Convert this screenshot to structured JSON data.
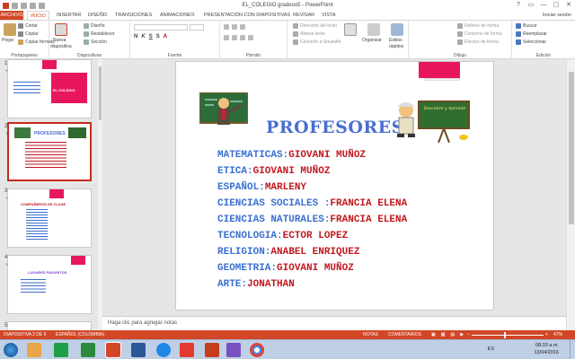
{
  "window": {
    "title": "EL_COLEGIO gradooo5 - PowerPoint"
  },
  "window_buttons": [
    "?",
    "▭",
    "—",
    "▢",
    "✕"
  ],
  "tabs": {
    "file": "ARCHIVO",
    "inicio": "INICIO",
    "insertar": "INSERTAR",
    "diseno": "DISEÑO",
    "transiciones": "TRANSICIONES",
    "animaciones": "ANIMACIONES",
    "presentacion": "PRESENTACIÓN CON DIAPOSITIVAS",
    "revisar": "REVISAR",
    "vista": "VISTA",
    "user": "Iniciar sesión"
  },
  "ribbon": {
    "pegar": "Pegar",
    "cortar": "Cortar",
    "copiar": "Copiar",
    "copiar_formato": "Copiar formato",
    "portapapeles": "Portapapeles",
    "nueva": "Nueva",
    "diapositiva": "diapositiva",
    "diseno": "Diseño",
    "restablecer": "Restablecer",
    "seccion": "Sección",
    "diapositivas": "Diapositivas",
    "fuente": "Fuente",
    "parrafo": "Párrafo",
    "direccion": "Dirección del texto",
    "alinear": "Alinear texto",
    "smartart": "Convertir a SmartArt",
    "organizar": "Organizar",
    "estilos": "Estilos",
    "rapidos": "rápidos",
    "relleno": "Relleno de forma",
    "contorno": "Contorno de forma",
    "efectos": "Efectos de forma",
    "dibujo": "Dibujo",
    "buscar": "Buscar",
    "reemplazar": "Reemplazar",
    "seleccionar": "Seleccionar",
    "edicion": "Edición"
  },
  "thumbnails": [
    {
      "num": "1",
      "title": "EL COLEGIO"
    },
    {
      "num": "2",
      "title": "PROFESORES"
    },
    {
      "num": "3",
      "title": "COMPAÑEROS DE CLASE"
    },
    {
      "num": "4",
      "title": "LUGARES FAVORITOS"
    },
    {
      "num": "5"
    }
  ],
  "slide": {
    "title": "PROFESORES",
    "sign_text": "Descubre y Aprende",
    "subjects": [
      {
        "k": "MATEMATICAS:",
        "v": "GIOVANI MUÑOZ"
      },
      {
        "k": "ETICA:",
        "v": "GIOVANI MUÑOZ"
      },
      {
        "k": "ESPAÑOL:",
        "v": "MARLENY"
      },
      {
        "k": "CIENCIAS SOCIALES :",
        "v": "FRANCIA ELENA"
      },
      {
        "k": "CIENCIAS NATURALES:",
        "v": "FRANCIA ELENA"
      },
      {
        "k": "TECNOLOGIA:",
        "v": "ECTOR LOPEZ"
      },
      {
        "k": "RELIGION:",
        "v": "ANABEL ENRIQUEZ"
      },
      {
        "k": "GEOMETRIA:",
        "v": "GIOVANI MUÑOZ"
      },
      {
        "k": "ARTE:",
        "v": "JONATHAN"
      }
    ]
  },
  "notes": {
    "placeholder": "Haga clic para agregar notas"
  },
  "status": {
    "slide": "DIAPOSITIVA 2 DE 6",
    "lang": "ESPAÑOL (COLOMBIA)",
    "notas": "NOTAS",
    "comentarios": "COMENTARIOS",
    "zoom": "47%"
  },
  "tray": {
    "time": "08:33 a.m.",
    "date": "13/04/2016",
    "lang": "ES"
  },
  "colors": {
    "accent": "#d24726",
    "pink_bar": "#e8175d",
    "title_blue": "#4a6fd0",
    "label_blue": "#3a6fcf",
    "value_red": "#c0181e"
  }
}
